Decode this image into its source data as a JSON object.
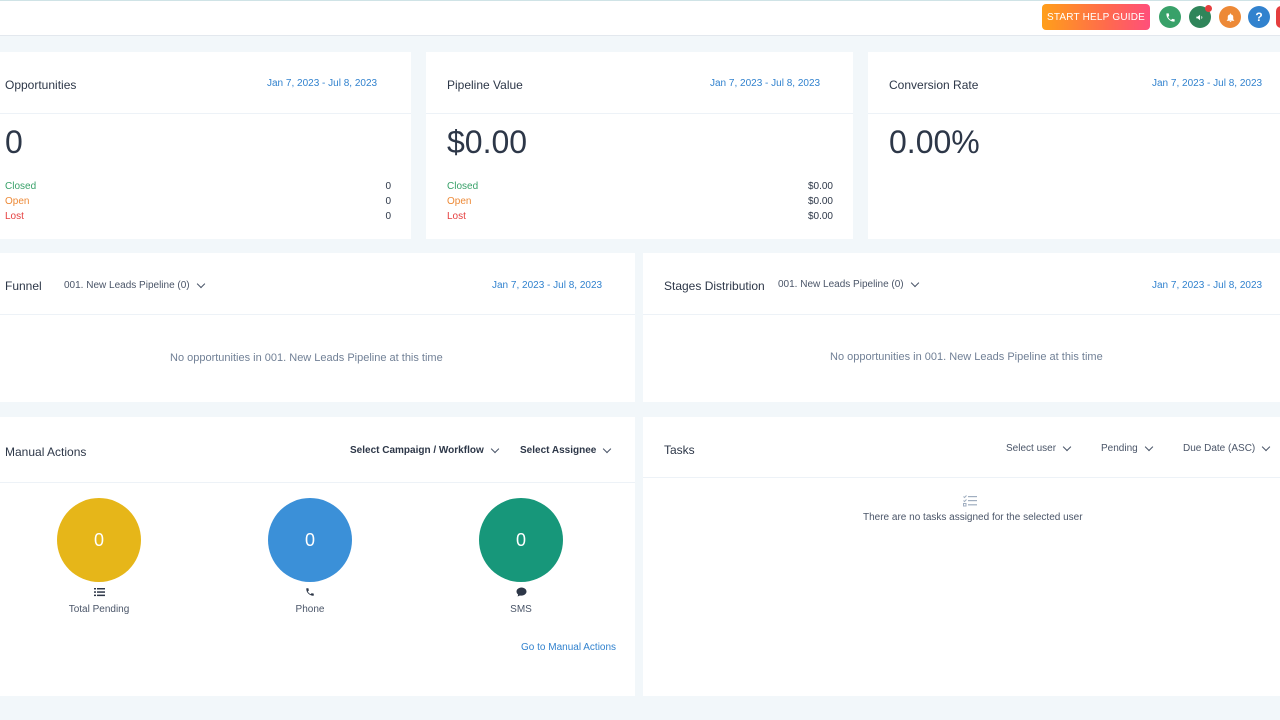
{
  "topbar": {
    "help_button": "START HELP GUIDE",
    "icons": [
      {
        "name": "phone-icon",
        "color": "#38a169",
        "glyph": "✆"
      },
      {
        "name": "megaphone-icon",
        "color": "#2f855a",
        "glyph": "📢"
      },
      {
        "name": "bell-icon",
        "color": "#ed8936",
        "glyph": "🔔"
      },
      {
        "name": "help-icon",
        "color": "#3182ce",
        "glyph": "?"
      }
    ]
  },
  "opportunities": {
    "title": "Opportunities",
    "date_range": "Jan 7, 2023 - Jul 8, 2023",
    "value": "0",
    "stats": [
      {
        "label": "Closed",
        "value": "0"
      },
      {
        "label": "Open",
        "value": "0"
      },
      {
        "label": "Lost",
        "value": "0"
      }
    ]
  },
  "pipeline_value": {
    "title": "Pipeline Value",
    "date_range": "Jan 7, 2023 - Jul 8, 2023",
    "value": "$0.00",
    "stats": [
      {
        "label": "Closed",
        "value": "$0.00"
      },
      {
        "label": "Open",
        "value": "$0.00"
      },
      {
        "label": "Lost",
        "value": "$0.00"
      }
    ]
  },
  "conversion_rate": {
    "title": "Conversion Rate",
    "date_range": "Jan 7, 2023 - Jul 8, 2023",
    "value": "0.00%"
  },
  "funnel": {
    "title": "Funnel",
    "pipeline": "001. New Leads Pipeline (0)",
    "date_range": "Jan 7, 2023 - Jul 8, 2023",
    "empty": "No opportunities in 001. New Leads Pipeline at this time"
  },
  "stages": {
    "title": "Stages Distribution",
    "pipeline": "001. New Leads Pipeline (0)",
    "date_range": "Jan 7, 2023 - Jul 8, 2023",
    "empty": "No opportunities in 001. New Leads Pipeline at this time"
  },
  "manual_actions": {
    "title": "Manual Actions",
    "campaign_select": "Select Campaign / Workflow",
    "assignee_select": "Select Assignee",
    "counters": [
      {
        "label": "Total Pending",
        "value": "0",
        "color": "#e6b619",
        "icon": "list-icon"
      },
      {
        "label": "Phone",
        "value": "0",
        "color": "#3b90d8",
        "icon": "phone-icon"
      },
      {
        "label": "SMS",
        "value": "0",
        "color": "#17977a",
        "icon": "chat-icon"
      }
    ],
    "link": "Go to Manual Actions"
  },
  "tasks": {
    "title": "Tasks",
    "user_select": "Select user",
    "status_select": "Pending",
    "sort_select": "Due Date (ASC)",
    "empty": "There are no tasks assigned for the selected user"
  }
}
